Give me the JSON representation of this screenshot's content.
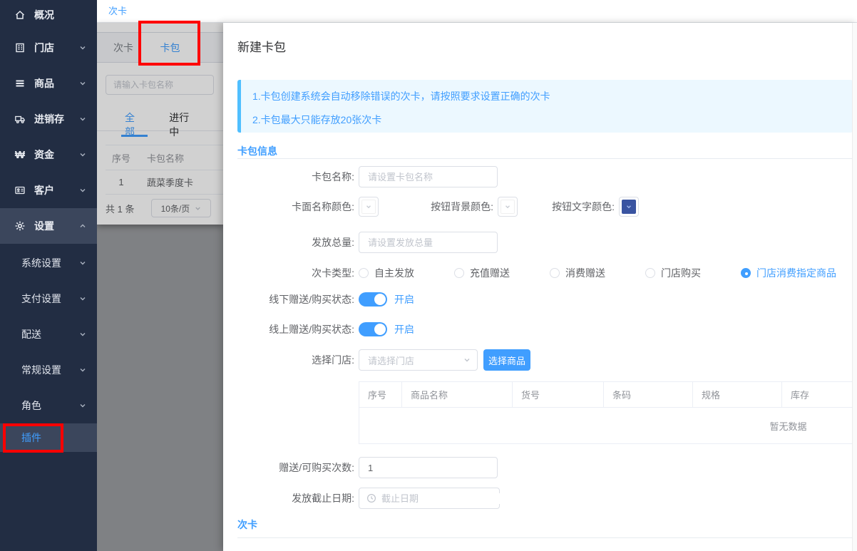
{
  "colors": {
    "accent": "#409EFF",
    "annotation_red": "#FF0000",
    "navy_swatch": "#3A54A1",
    "sidebar_bg": "#222D43",
    "sidebar_active_bg": "#3B465C",
    "notice_bg": "#ECF8FF",
    "notice_border": "#50BFFF"
  },
  "topbar": {
    "active_tab": "次卡"
  },
  "sidebar": {
    "items": [
      {
        "label": "概况",
        "icon": "home-icon"
      },
      {
        "label": "门店",
        "icon": "store-icon",
        "chevron": "down"
      },
      {
        "label": "商品",
        "icon": "menu-icon",
        "chevron": "down"
      },
      {
        "label": "进销存",
        "icon": "truck-icon",
        "chevron": "down"
      },
      {
        "label": "资金",
        "icon": "won-icon",
        "chevron": "down"
      },
      {
        "label": "客户",
        "icon": "idcard-icon",
        "chevron": "down"
      },
      {
        "label": "设置",
        "icon": "gear-icon",
        "chevron": "up",
        "active": true
      }
    ],
    "settings_children": [
      {
        "label": "系统设置",
        "chevron": "down"
      },
      {
        "label": "支付设置",
        "chevron": "down"
      },
      {
        "label": "配送",
        "chevron": "down"
      },
      {
        "label": "常规设置",
        "chevron": "down"
      },
      {
        "label": "角色",
        "chevron": "down"
      },
      {
        "label": "插件",
        "active": true
      }
    ]
  },
  "list_panel": {
    "tabs": [
      {
        "label": "次卡"
      },
      {
        "label": "卡包",
        "active": true
      }
    ],
    "search_placeholder": "请输入卡包名称",
    "filter_tabs": [
      {
        "label": "全部",
        "active": true
      },
      {
        "label": "进行中"
      }
    ],
    "table": {
      "headers": [
        "序号",
        "卡包名称"
      ],
      "rows": [
        {
          "index": "1",
          "name": "蔬菜季度卡"
        }
      ]
    },
    "footer": {
      "total": "共 1 条",
      "page_size": "10条/页"
    }
  },
  "drawer": {
    "title": "新建卡包",
    "notice_lines": [
      "1.卡包创建系统会自动移除错误的次卡，请按照要求设置正确的次卡",
      "2.卡包最大只能存放20张次卡"
    ],
    "section_package_info": "卡包信息",
    "section_cika": "次卡",
    "fields": {
      "package_name": {
        "label": "卡包名称:",
        "placeholder": "请设置卡包名称"
      },
      "card_name_color": {
        "label": "卡面名称颜色:"
      },
      "button_bg_color": {
        "label": "按钮背景颜色:"
      },
      "button_text_color": {
        "label": "按钮文字颜色:"
      },
      "total_issue": {
        "label": "发放总量:",
        "placeholder": "请设置发放总量"
      },
      "card_type": {
        "label": "次卡类型:"
      },
      "offline_status": {
        "label": "线下赠送/购买状态:",
        "state": "开启"
      },
      "online_status": {
        "label": "线上赠送/购买状态:",
        "state": "开启"
      },
      "store_select": {
        "label": "选择门店:",
        "placeholder": "请选择门店",
        "button": "选择商品"
      },
      "purchase_times": {
        "label": "赠送/可购买次数:",
        "value": "1"
      },
      "deadline": {
        "label": "发放截止日期:",
        "placeholder": "截止日期"
      }
    },
    "card_type_options": [
      {
        "label": "自主发放"
      },
      {
        "label": "充值赠送"
      },
      {
        "label": "消费赠送"
      },
      {
        "label": "门店购买"
      },
      {
        "label": "门店消费指定商品",
        "selected": true
      }
    ],
    "product_table": {
      "headers": [
        "序号",
        "商品名称",
        "货号",
        "条码",
        "规格",
        "库存"
      ],
      "empty_text": "暂无数据"
    }
  }
}
